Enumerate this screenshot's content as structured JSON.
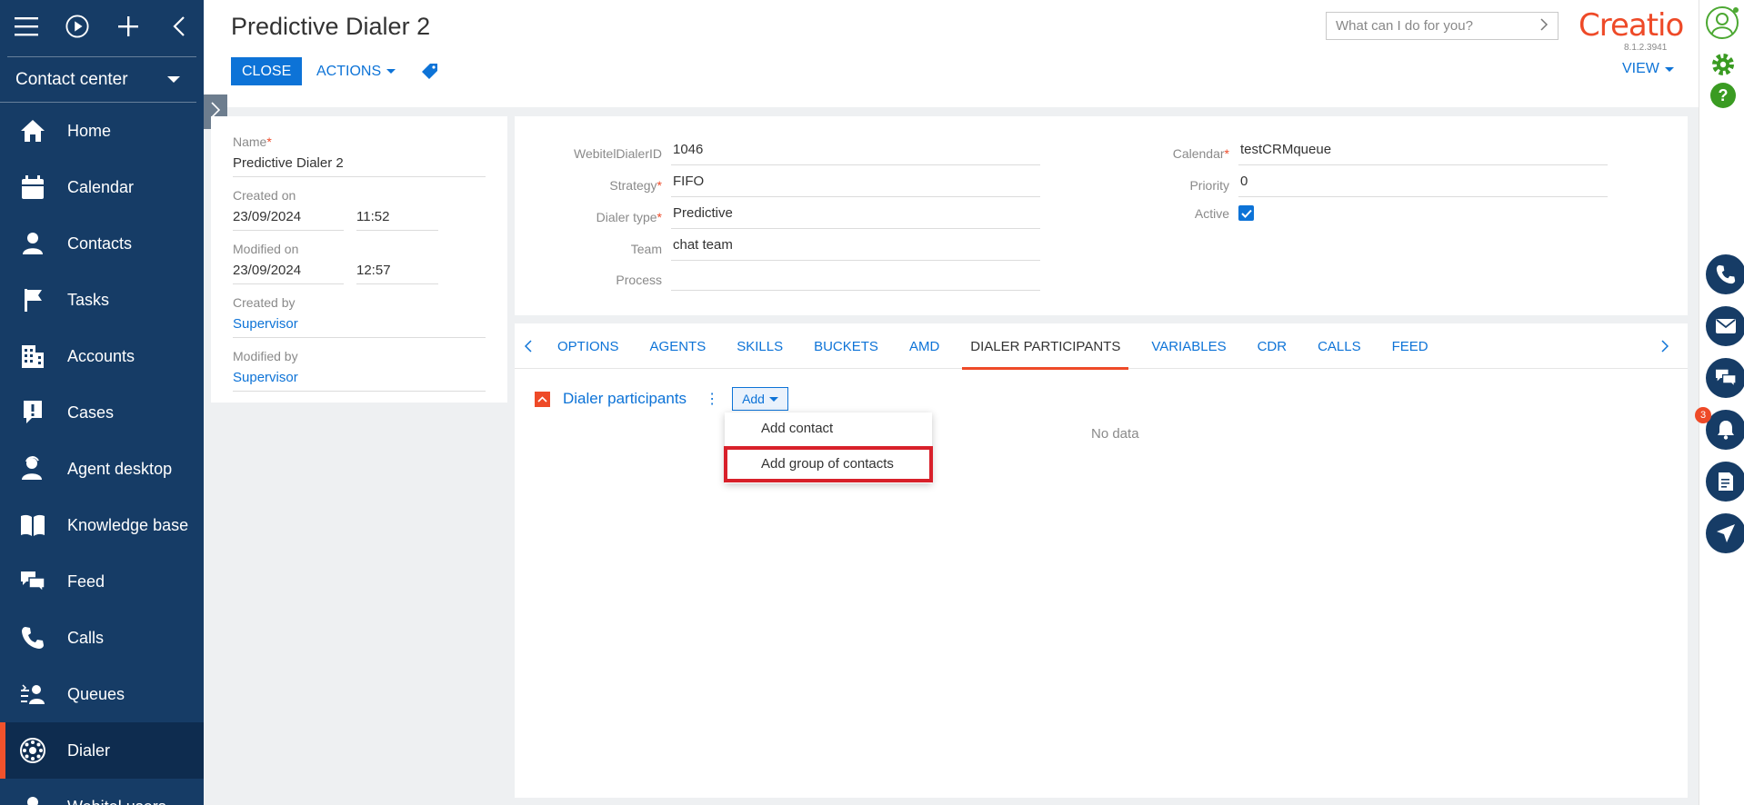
{
  "sidebar": {
    "workplace": "Contact center",
    "items": [
      {
        "label": "Home",
        "icon": "home-icon"
      },
      {
        "label": "Calendar",
        "icon": "calendar-icon"
      },
      {
        "label": "Contacts",
        "icon": "contacts-icon"
      },
      {
        "label": "Tasks",
        "icon": "tasks-icon"
      },
      {
        "label": "Accounts",
        "icon": "accounts-icon"
      },
      {
        "label": "Cases",
        "icon": "cases-icon"
      },
      {
        "label": "Agent desktop",
        "icon": "agent-desktop-icon"
      },
      {
        "label": "Knowledge base",
        "icon": "knowledge-base-icon"
      },
      {
        "label": "Feed",
        "icon": "feed-icon"
      },
      {
        "label": "Calls",
        "icon": "calls-icon"
      },
      {
        "label": "Queues",
        "icon": "queues-icon"
      },
      {
        "label": "Dialer",
        "icon": "dialer-icon"
      },
      {
        "label": "Webitel users",
        "icon": "webitel-users-icon"
      }
    ]
  },
  "header": {
    "title": "Predictive Dialer 2",
    "close_label": "CLOSE",
    "actions_label": "ACTIONS",
    "search_placeholder": "What can I do for you?",
    "logo": "Creatio",
    "version": "8.1.2.3941",
    "view_label": "VIEW"
  },
  "info": {
    "name_label": "Name",
    "name_value": "Predictive Dialer 2",
    "created_on_label": "Created on",
    "created_on_date": "23/09/2024",
    "created_on_time": "11:52",
    "modified_on_label": "Modified on",
    "modified_on_date": "23/09/2024",
    "modified_on_time": "12:57",
    "created_by_label": "Created by",
    "created_by_value": "Supervisor",
    "modified_by_label": "Modified by",
    "modified_by_value": "Supervisor"
  },
  "details": {
    "webitel_id_label": "WebitelDialerID",
    "webitel_id_value": "1046",
    "strategy_label": "Strategy",
    "strategy_value": "FIFO",
    "dialer_type_label": "Dialer type",
    "dialer_type_value": "Predictive",
    "team_label": "Team",
    "team_value": "chat  team",
    "process_label": "Process",
    "process_value": "",
    "calendar_label": "Calendar",
    "calendar_value": "testCRMqueue",
    "priority_label": "Priority",
    "priority_value": "0",
    "active_label": "Active",
    "active_checked": true
  },
  "tabs": [
    "OPTIONS",
    "AGENTS",
    "SKILLS",
    "BUCKETS",
    "AMD",
    "DIALER PARTICIPANTS",
    "VARIABLES",
    "CDR",
    "CALLS",
    "FEED"
  ],
  "active_tab": "DIALER PARTICIPANTS",
  "participants": {
    "title": "Dialer participants",
    "add_label": "Add",
    "no_data": "No data",
    "menu": [
      "Add contact",
      "Add group of contacts"
    ]
  },
  "notifications_count": "3",
  "colors": {
    "sidebar": "#163c66",
    "accent": "#ee4a28",
    "primary": "#0d73d7",
    "highlight": "#d8202a"
  }
}
